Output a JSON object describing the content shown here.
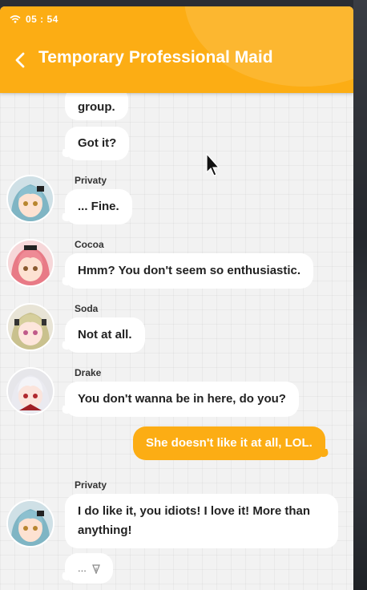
{
  "status_bar": {
    "time": "05 : 54",
    "wifi_icon": "wifi-icon"
  },
  "header": {
    "back_icon": "back-arrow-icon",
    "title": "Temporary Professional Maid"
  },
  "colors": {
    "accent": "#fcad14",
    "bubble": "#ffffff",
    "background": "#f2f2f2"
  },
  "messages": [
    {
      "sender": "",
      "text": "group."
    },
    {
      "sender": "",
      "text": "Got it?"
    },
    {
      "sender": "Privaty",
      "text": "... Fine."
    },
    {
      "sender": "Cocoa",
      "text": "Hmm? You don't seem so enthusiastic."
    },
    {
      "sender": "Soda",
      "text": "Not at all."
    },
    {
      "sender": "Drake",
      "text": "You don't wanna be in here, do you?"
    },
    {
      "sender": "me",
      "text": "She doesn't like it at all, LOL."
    },
    {
      "sender": "Privaty",
      "text": "I do like it, you idiots! I love it! More than anything!"
    },
    {
      "sender": "",
      "text": "..."
    }
  ],
  "typing_indicator_icon": "next-arrow-icon"
}
